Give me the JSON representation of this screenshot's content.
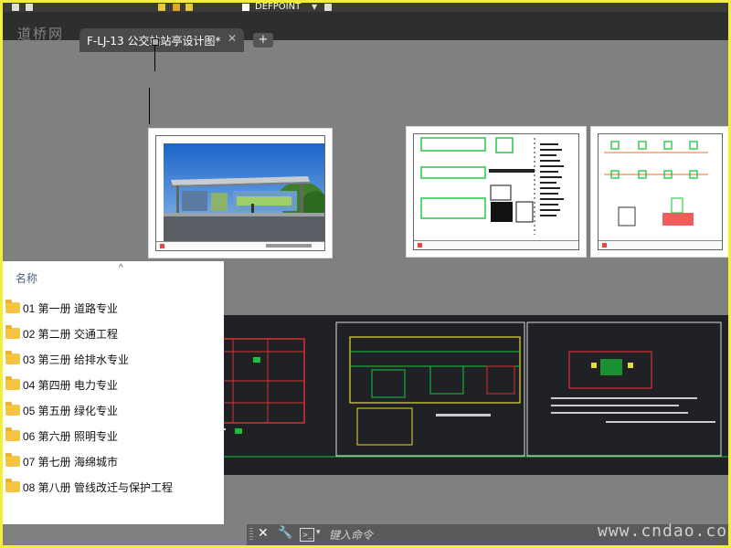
{
  "toolbar": {
    "layer_name": "DEFPOINT"
  },
  "watermark_logo": "道桥网",
  "tabs": [
    {
      "label": "F-LJ-13 公交站站亭设计图*",
      "close_icon": "close-icon"
    }
  ],
  "tab_add_label": "+",
  "explorer": {
    "column_header": "名称",
    "sort_indicator": "^",
    "folders": [
      "01 第一册 道路专业",
      "02 第二册 交通工程",
      "03 第三册 给排水专业",
      "04 第四册 电力专业",
      "05 第五册 绿化专业",
      "06 第六册 照明专业",
      "07 第七册 海绵城市",
      "08 第八册 管线改迁与保护工程"
    ]
  },
  "command_line": {
    "close_label": "✕",
    "tool_label": "🔧",
    "placeholder": "键入命令"
  },
  "site_watermark": "www.cndao.com",
  "colors": {
    "frame": "#f2ef3a",
    "model_space": "#808080",
    "cad_dark": "#202124",
    "folder": "#f4c542"
  }
}
